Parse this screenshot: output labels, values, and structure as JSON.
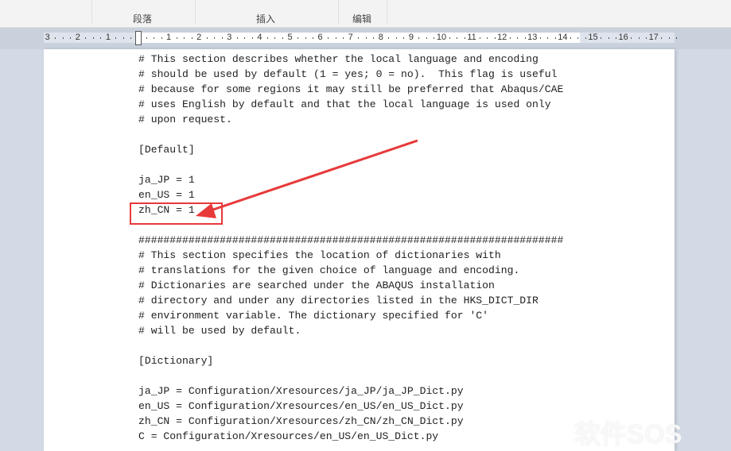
{
  "ribbon": {
    "groups": [
      "段落",
      "插入",
      "编辑"
    ]
  },
  "ruler": {
    "labels": [
      "3",
      "2",
      "1",
      "",
      "1",
      "2",
      "3",
      "4",
      "5",
      "6",
      "7",
      "8",
      "9",
      "10",
      "11",
      "12",
      "13",
      "14",
      "15",
      "16",
      "17"
    ]
  },
  "document": {
    "lines": [
      "# This section describes whether the local language and encoding",
      "# should be used by default (1 = yes; 0 = no).  This flag is useful",
      "# because for some regions it may still be preferred that Abaqus/CAE",
      "# uses English by default and that the local language is used only",
      "# upon request.",
      "",
      "[Default]",
      "",
      "ja_JP = 1",
      "en_US = 1",
      "zh_CN = 1",
      "",
      "####################################################################",
      "# This section specifies the location of dictionaries with",
      "# translations for the given choice of language and encoding.",
      "# Dictionaries are searched under the ABAQUS installation",
      "# directory and under any directories listed in the HKS_DICT_DIR",
      "# environment variable. The dictionary specified for 'C'",
      "# will be used by default.",
      "",
      "[Dictionary]",
      "",
      "ja_JP = Configuration/Xresources/ja_JP/ja_JP_Dict.py",
      "en_US = Configuration/Xresources/en_US/en_US_Dict.py",
      "zh_CN = Configuration/Xresources/zh_CN/zh_CN_Dict.py",
      "C = Configuration/Xresources/en_US/en_US_Dict.py"
    ]
  },
  "annotation": {
    "color": "#e8393a",
    "target": "zh_CN = 1"
  },
  "watermark": "软件SOS"
}
